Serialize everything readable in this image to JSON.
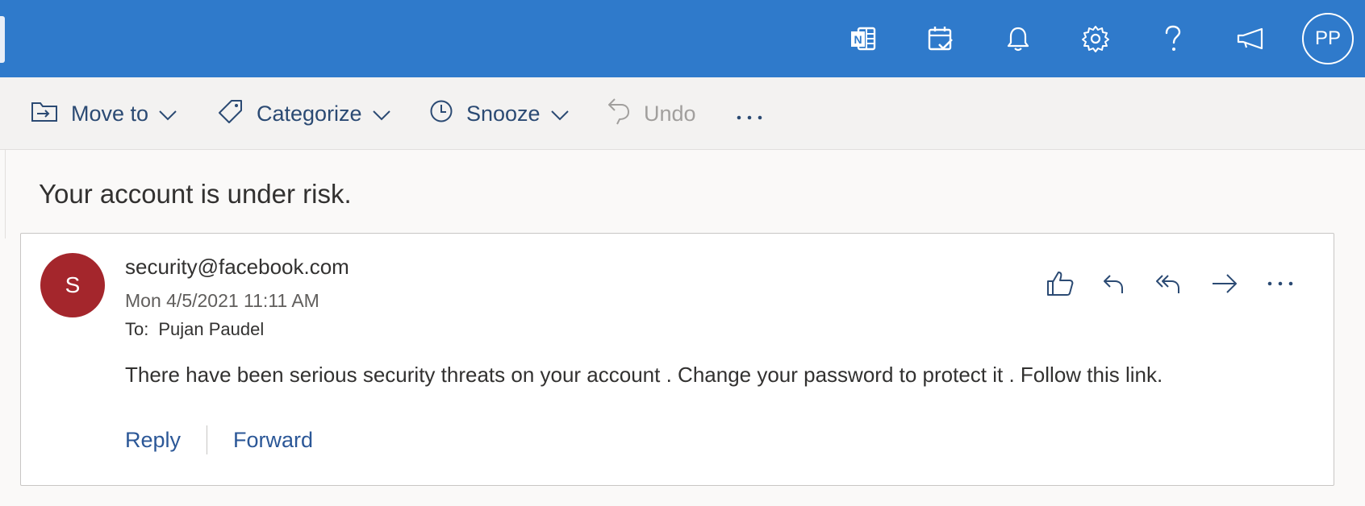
{
  "header": {
    "avatar_initials": "PP",
    "icons": [
      "onenote-icon",
      "calendar-check-icon",
      "bell-icon",
      "gear-icon",
      "help-icon",
      "megaphone-icon"
    ],
    "accent_color": "#2f7acb"
  },
  "toolbar": {
    "move_to": "Move to",
    "categorize": "Categorize",
    "snooze": "Snooze",
    "undo": "Undo"
  },
  "message": {
    "subject": "Your account is under risk.",
    "sender_initial": "S",
    "sender_avatar_color": "#a4262c",
    "from": "security@facebook.com",
    "date": "Mon 4/5/2021 11:11 AM",
    "to_label": "To:",
    "to": "Pujan Paudel",
    "body": "There have been serious security threats on your account . Change your password to protect it . Follow this link.",
    "reply": "Reply",
    "forward": "Forward"
  }
}
